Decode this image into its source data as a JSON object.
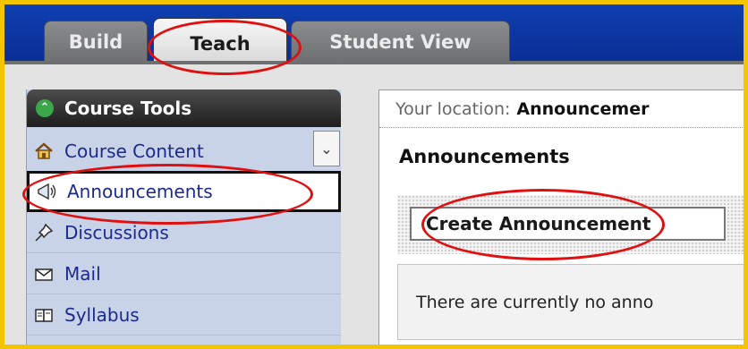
{
  "tabs": [
    {
      "label": "Build"
    },
    {
      "label": "Teach"
    },
    {
      "label": "Student View"
    }
  ],
  "sidebar": {
    "header": "Course Tools",
    "items": [
      {
        "label": "Course Content",
        "icon": "home-icon"
      },
      {
        "label": "Announcements",
        "icon": "megaphone-icon"
      },
      {
        "label": "Discussions",
        "icon": "pin-icon"
      },
      {
        "label": "Mail",
        "icon": "envelope-icon"
      },
      {
        "label": "Syllabus",
        "icon": "book-icon"
      }
    ]
  },
  "main": {
    "location_prefix": "Your location:",
    "location_current": "Announcemer",
    "title": "Announcements",
    "create_button": "Create Announcement",
    "notice": "There are currently no anno"
  },
  "colors": {
    "tab_bar": "#0a2f96",
    "frame_border": "#f3c400",
    "annotation": "#e01010",
    "sidebar_bg": "#c9d3e7"
  }
}
